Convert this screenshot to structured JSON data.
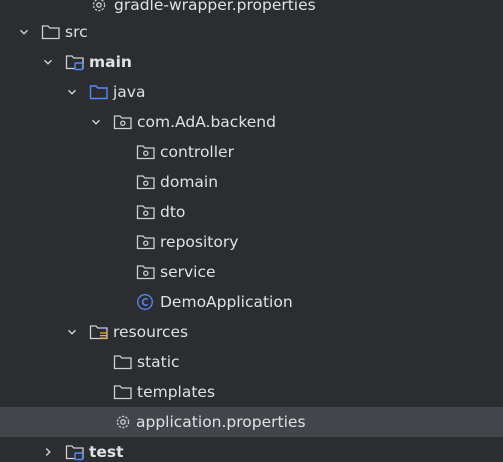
{
  "project_tree": {
    "accent_color": "#548af7",
    "items": [
      {
        "label": "gradle-wrapper.properties",
        "icon": "gear-icon"
      },
      {
        "label": "src",
        "icon": "folder-icon",
        "expanded": true
      },
      {
        "label": "main",
        "icon": "source-root-folder-icon",
        "expanded": true
      },
      {
        "label": "java",
        "icon": "sources-folder-icon",
        "expanded": true
      },
      {
        "label": "com.AdA.backend",
        "icon": "package-icon",
        "expanded": true
      },
      {
        "label": "controller",
        "icon": "package-icon"
      },
      {
        "label": "domain",
        "icon": "package-icon"
      },
      {
        "label": "dto",
        "icon": "package-icon"
      },
      {
        "label": "repository",
        "icon": "package-icon"
      },
      {
        "label": "service",
        "icon": "package-icon"
      },
      {
        "label": "DemoApplication",
        "icon": "class-icon"
      },
      {
        "label": "resources",
        "icon": "resources-folder-icon",
        "expanded": true
      },
      {
        "label": "static",
        "icon": "folder-icon"
      },
      {
        "label": "templates",
        "icon": "folder-icon"
      },
      {
        "label": "application.properties",
        "icon": "gear-icon",
        "selected": true
      },
      {
        "label": "test",
        "icon": "source-root-folder-icon",
        "expanded": false
      }
    ]
  }
}
